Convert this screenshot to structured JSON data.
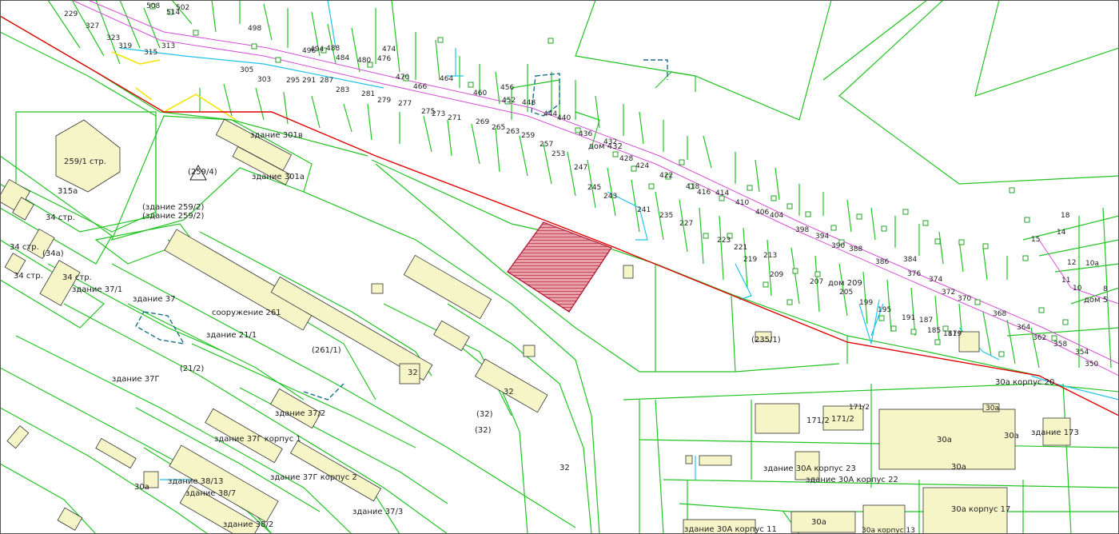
{
  "colors": {
    "parcel": "#22c422",
    "building_fill": "#f6f5c8",
    "building_stroke": "#333333",
    "road": "#d64fd6",
    "water": "#20c4e8",
    "boundary": "#e00000",
    "highlight": "#e8a0a8",
    "highlight_hatch": "#b01030",
    "yellow_line": "#f2e600"
  },
  "selected_parcel": {
    "icon": "hatched-polygon"
  },
  "labels": {
    "l_259_1": "259/1 стр.",
    "l_315a": "315а",
    "l_34str_a": "34 стр.",
    "l_34str_b": "34 стр.",
    "l_34str_c": "34 стр.",
    "l_34str_d": "34 стр.",
    "l_34a": "(34а)",
    "l_259_4": "(259/4)",
    "l_259_2a": "(здание 259/2)",
    "l_259_2b": "(здание 259/2)",
    "l_301v": "здание 301в",
    "l_301a": "здание 301а",
    "l_37_1": "здание 37/1",
    "l_37": "здание 37",
    "l_soor_261": "сооружение 261",
    "l_21_1": "здание 21/1",
    "l_261_1": "(261/1)",
    "l_37g": "здание 37Г",
    "l_21_2": "(21/2)",
    "l_37_2": "здание 37/2",
    "l_37g_k1": "здание 37Г корпус 1",
    "l_37g_k2": "здание 37Г корпус 2",
    "l_37_3": "здание 37/3",
    "l_38_13": "здание 38/13",
    "l_38_7": "здание 38/7",
    "l_38_2": "здание 38/2",
    "l_30a_left": "30а",
    "l_32_a": "32",
    "l_32_b": "32",
    "l_32_c": "(32)",
    "l_32_d": "(32)",
    "l_32_e": "32",
    "l_235_1": "(235/1)",
    "l_dom432": "дом 432",
    "l_dom209": "дом 209",
    "l_dom5": "дом 5",
    "l_30a_k20": "30а корпус 20",
    "l_171_2a": "171/2",
    "l_171_2b": "171/2",
    "l_171_2c": "171/2",
    "l_30a_big": "30а",
    "l_30a_b": "30а",
    "l_30a_c": "30а",
    "l_30a_d": "30а",
    "l_zd173": "здание 173",
    "l_30A_k23": "здание 30А корпус 23",
    "l_30A_k22": "здание 30А корпус 22",
    "l_30a_k17": "30а корпус 17",
    "l_30A_k11": "здание 30А корпус 11",
    "l_30a_bottom": "30а",
    "l_30a_k13": "30а корпус 13"
  },
  "house_numbers": [
    "229",
    "327",
    "323",
    "319",
    "315",
    "313",
    "305",
    "303",
    "295",
    "291",
    "287",
    "283",
    "281",
    "279",
    "277",
    "275",
    "273",
    "271",
    "269",
    "265",
    "263",
    "259",
    "257",
    "253",
    "247",
    "245",
    "243",
    "241",
    "235",
    "227",
    "223",
    "221",
    "219",
    "213",
    "209",
    "207",
    "205",
    "199",
    "195",
    "191",
    "187",
    "185",
    "181",
    "179",
    "502",
    "508",
    "514",
    "498",
    "496",
    "494",
    "488",
    "484",
    "480",
    "476",
    "474",
    "470",
    "466",
    "464",
    "460",
    "456",
    "452",
    "448",
    "444",
    "440",
    "436",
    "432",
    "428",
    "424",
    "422",
    "418",
    "416",
    "414",
    "410",
    "406",
    "404",
    "398",
    "394",
    "390",
    "388",
    "386",
    "384",
    "376",
    "374",
    "372",
    "370",
    "368",
    "364",
    "362",
    "358",
    "354",
    "350",
    "18",
    "15",
    "14",
    "12",
    "10а",
    "11",
    "10",
    "8"
  ]
}
